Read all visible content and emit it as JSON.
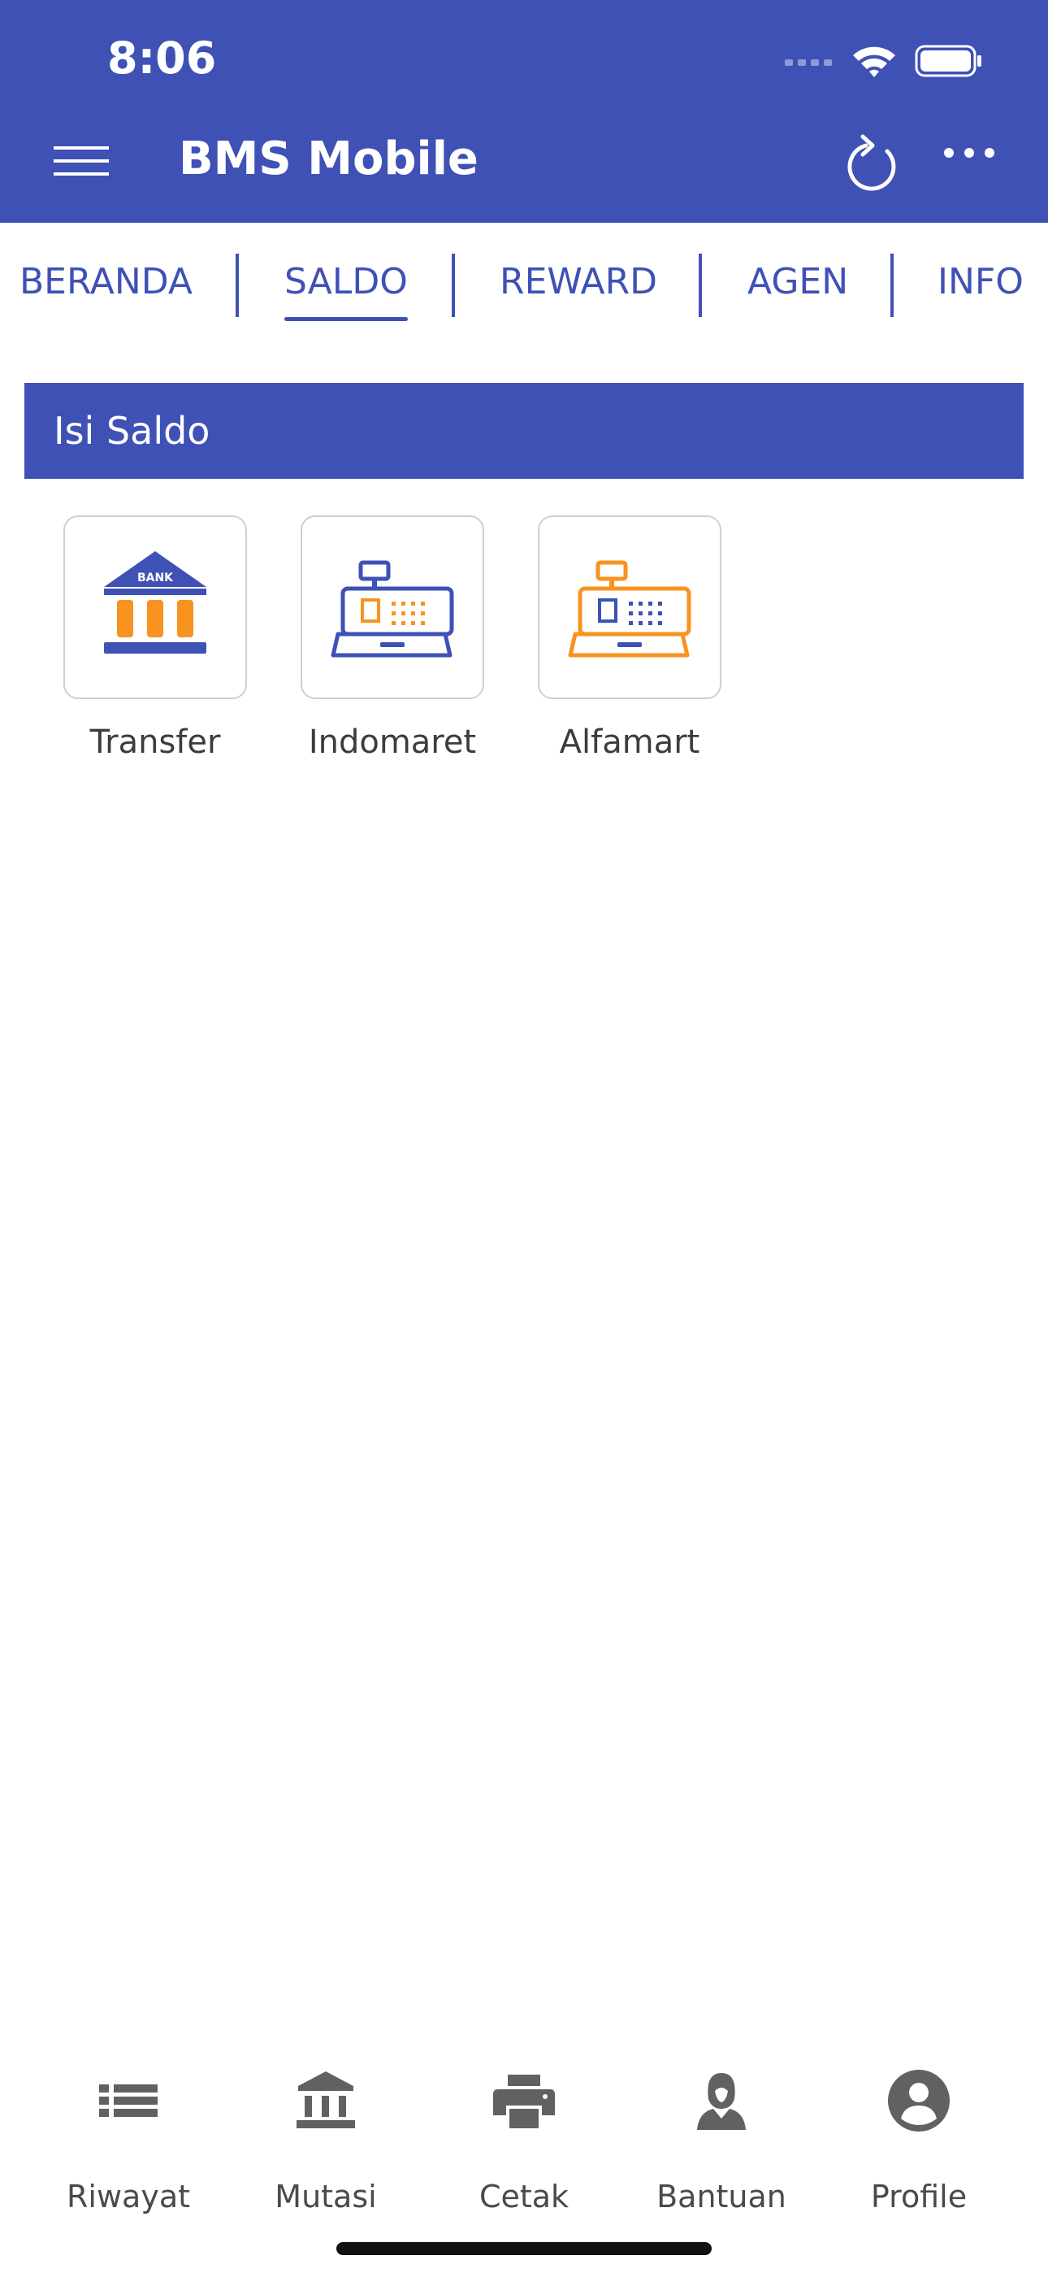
{
  "status": {
    "time": "8:06"
  },
  "app": {
    "title": "BMS Mobile"
  },
  "tabs": [
    {
      "label": "BERANDA",
      "active": false
    },
    {
      "label": "SALDO",
      "active": true
    },
    {
      "label": "REWARD",
      "active": false
    },
    {
      "label": "AGEN",
      "active": false
    },
    {
      "label": "INFO",
      "active": false
    }
  ],
  "section": {
    "title": "Isi Saldo"
  },
  "options": [
    {
      "label": "Transfer",
      "icon": "bank-icon",
      "badge": "BANK"
    },
    {
      "label": "Indomaret",
      "icon": "cash-register-blue-icon"
    },
    {
      "label": "Alfamart",
      "icon": "cash-register-orange-icon"
    }
  ],
  "bottom_nav": [
    {
      "label": "Riwayat",
      "icon": "list-icon"
    },
    {
      "label": "Mutasi",
      "icon": "bank-building-icon"
    },
    {
      "label": "Cetak",
      "icon": "printer-icon"
    },
    {
      "label": "Bantuan",
      "icon": "support-agent-icon"
    },
    {
      "label": "Profile",
      "icon": "account-icon"
    }
  ],
  "colors": {
    "primary": "#3f51b5",
    "accent_orange": "#f7931e",
    "icon_gray": "#616161"
  }
}
